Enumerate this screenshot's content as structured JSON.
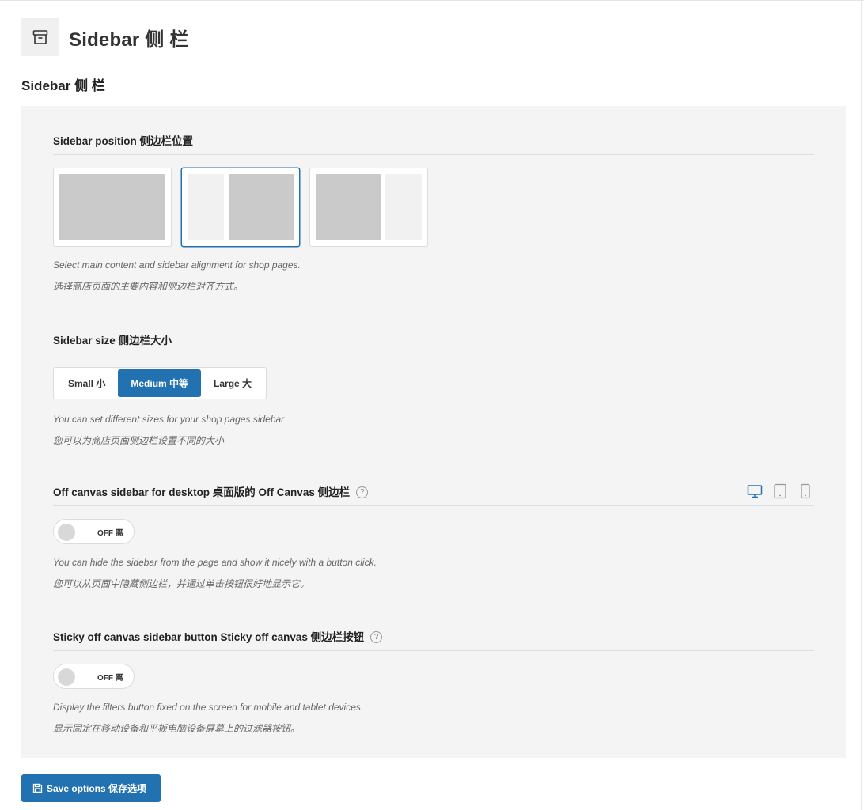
{
  "header": {
    "title": "Sidebar  侧 栏",
    "icon": "archive-box-icon"
  },
  "section_title": "Sidebar  侧 栏",
  "fields": {
    "position": {
      "label": "Sidebar position  侧边栏位置",
      "options": [
        "no-sidebar",
        "left-sidebar",
        "right-sidebar"
      ],
      "selected": "left-sidebar",
      "desc_en": "Select main content and sidebar alignment for shop pages.",
      "desc_zh": "选择商店页面的主要内容和侧边栏对齐方式。"
    },
    "size": {
      "label": "Sidebar size  侧边栏大小",
      "options": [
        "Small  小",
        "Medium  中等",
        "Large  大"
      ],
      "selected": "Medium  中等",
      "desc_en": "You can set different sizes for your shop pages sidebar",
      "desc_zh": "您可以为商店页面侧边栏设置不同的大小"
    },
    "offcanvas": {
      "label": "Off canvas sidebar for desktop  桌面版的 Off Canvas 侧边栏",
      "help": "?",
      "toggle": "OFF  离",
      "devices": [
        "desktop",
        "tablet",
        "mobile"
      ],
      "active_device": "desktop",
      "desc_en": "You can hide the sidebar from the page and show it nicely with a button click.",
      "desc_zh": "您可以从页面中隐藏侧边栏，并通过单击按钮很好地显示它。"
    },
    "sticky": {
      "label": "Sticky off canvas sidebar button  Sticky off canvas 侧边栏按钮",
      "help": "?",
      "toggle": "OFF  离",
      "desc_en": "Display the filters button fixed on the screen for mobile and tablet devices.",
      "desc_zh": "显示固定在移动设备和平板电脑设备屏幕上的过滤器按钮。"
    }
  },
  "save_button": {
    "label": "Save options  保存选项"
  },
  "colors": {
    "accent": "#2271b1",
    "panel_bg": "#f4f4f4",
    "placeholder_block": "#cacaca"
  }
}
